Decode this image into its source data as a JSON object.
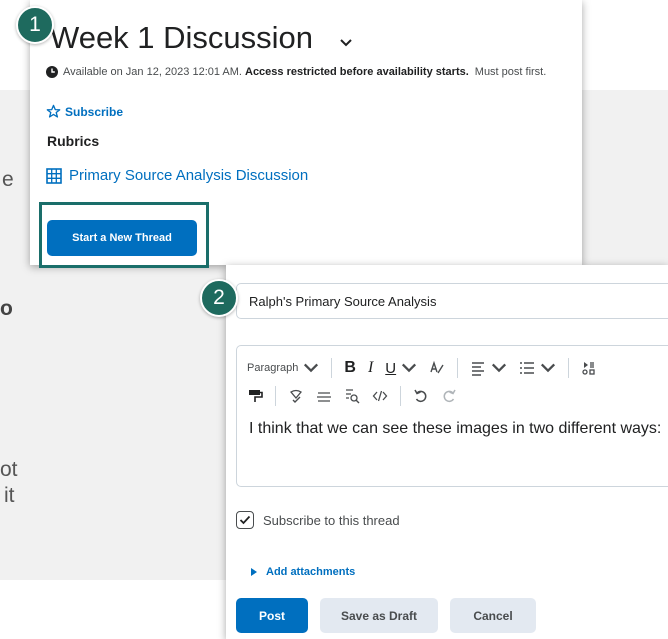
{
  "background": {
    "frag_e": "e",
    "frag_o": "o",
    "frag_ot": "ot",
    "frag_it": "it"
  },
  "badges": {
    "one": "1",
    "two": "2"
  },
  "discussion": {
    "title": "Week 1 Discussion",
    "availability_prefix": "Available on Jan 12, 2023 12:01 AM.",
    "availability_restriction": "Access restricted before availability starts.",
    "availability_note": "Must post first.",
    "subscribe_label": "Subscribe",
    "rubrics_heading": "Rubrics",
    "rubric_link": "Primary Source Analysis Discussion",
    "start_thread_label": "Start a New Thread"
  },
  "thread_form": {
    "title_value": "Ralph's Primary Source Analysis",
    "toolbar": {
      "format_select": "Paragraph",
      "bold": "B",
      "italic": "I",
      "underline": "U"
    },
    "body_text": "I think that we can see these images in two different ways:",
    "subscribe_checkbox_label": "Subscribe to this thread",
    "subscribe_checked": true,
    "add_attachments_label": "Add attachments",
    "post_label": "Post",
    "save_draft_label": "Save as Draft",
    "cancel_label": "Cancel"
  },
  "colors": {
    "accent": "#006fbf",
    "badge": "#1e6a5e",
    "highlight_frame": "#1a6e6a"
  }
}
